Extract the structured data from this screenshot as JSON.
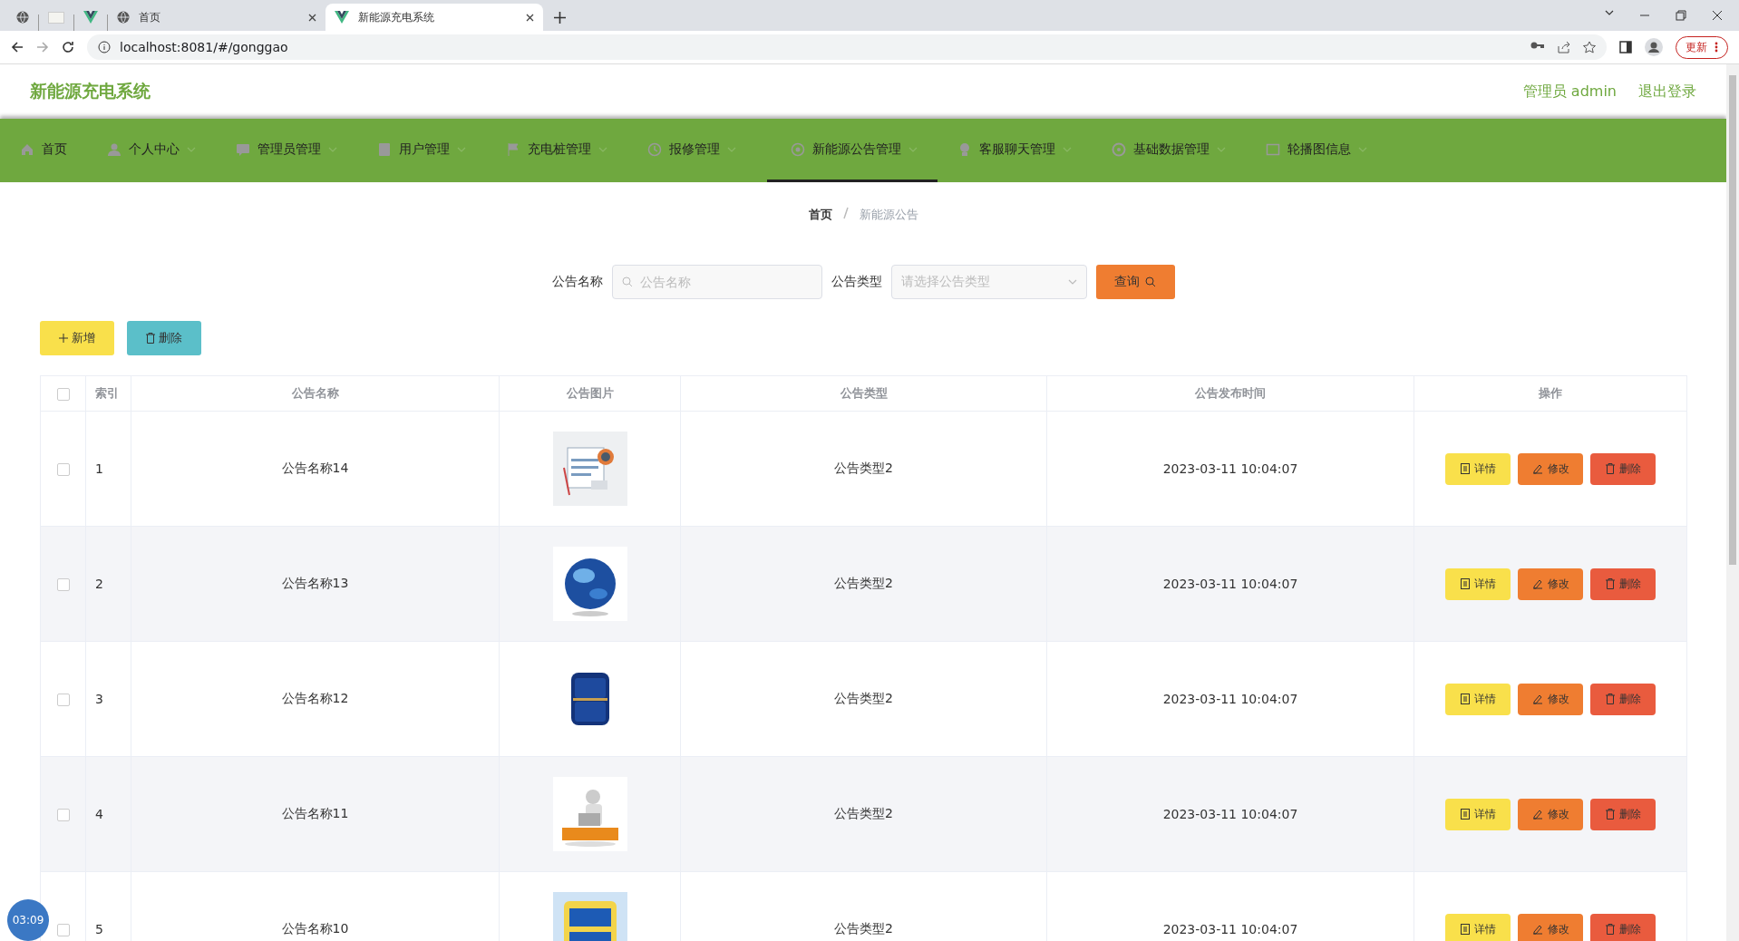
{
  "browser": {
    "tabs": [
      {
        "kind": "globe",
        "selected": false
      },
      {
        "kind": "blank",
        "selected": false
      },
      {
        "kind": "vue",
        "selected": false
      },
      {
        "kind": "globe",
        "title": "首页",
        "selected": false
      },
      {
        "kind": "vue",
        "title": "新能源充电系统",
        "selected": true
      }
    ],
    "url": "localhost:8081/#/gonggao",
    "update_button": "更新"
  },
  "header": {
    "title": "新能源充电系统",
    "user": "管理员 admin",
    "logout": "退出登录"
  },
  "nav": [
    {
      "label": "首页",
      "dropdown": false,
      "selected": false
    },
    {
      "label": "个人中心",
      "dropdown": true,
      "selected": false
    },
    {
      "label": "管理员管理",
      "dropdown": true,
      "selected": false
    },
    {
      "label": "用户管理",
      "dropdown": true,
      "selected": false
    },
    {
      "label": "充电桩管理",
      "dropdown": true,
      "selected": false
    },
    {
      "label": "报修管理",
      "dropdown": true,
      "selected": false
    },
    {
      "label": "新能源公告管理",
      "dropdown": true,
      "selected": true
    },
    {
      "label": "客服聊天管理",
      "dropdown": true,
      "selected": false
    },
    {
      "label": "基础数据管理",
      "dropdown": true,
      "selected": false
    },
    {
      "label": "轮播图信息",
      "dropdown": true,
      "selected": false
    }
  ],
  "breadcrumb": [
    "首页",
    "新能源公告"
  ],
  "search": {
    "name_label": "公告名称",
    "name_placeholder": "公告名称",
    "type_label": "公告类型",
    "type_placeholder": "请选择公告类型",
    "query_button": "查询"
  },
  "toolbar": [
    {
      "kind": "add",
      "label": "新增"
    },
    {
      "kind": "delete",
      "label": "删除"
    }
  ],
  "table": {
    "select_all_checked": false,
    "columns": [
      "索引",
      "公告名称",
      "公告图片",
      "公告类型",
      "公告发布时间",
      "操作"
    ],
    "rows": [
      {
        "index": "1",
        "name": "公告名称14",
        "type": "公告类型2",
        "time": "2023-03-11 10:04:07",
        "selected": false,
        "actions": [
          {
            "kind": "detail",
            "label": "详情"
          },
          {
            "kind": "edit",
            "label": "修改"
          },
          {
            "kind": "delete",
            "label": "删除"
          }
        ]
      },
      {
        "index": "2",
        "name": "公告名称13",
        "type": "公告类型2",
        "time": "2023-03-11 10:04:07",
        "selected": false,
        "actions": [
          {
            "kind": "detail",
            "label": "详情"
          },
          {
            "kind": "edit",
            "label": "修改"
          },
          {
            "kind": "delete",
            "label": "删除"
          }
        ]
      },
      {
        "index": "3",
        "name": "公告名称12",
        "type": "公告类型2",
        "time": "2023-03-11 10:04:07",
        "selected": false,
        "actions": [
          {
            "kind": "detail",
            "label": "详情"
          },
          {
            "kind": "edit",
            "label": "修改"
          },
          {
            "kind": "delete",
            "label": "删除"
          }
        ]
      },
      {
        "index": "4",
        "name": "公告名称11",
        "type": "公告类型2",
        "time": "2023-03-11 10:04:07",
        "selected": false,
        "actions": [
          {
            "kind": "detail",
            "label": "详情"
          },
          {
            "kind": "edit",
            "label": "修改"
          },
          {
            "kind": "delete",
            "label": "删除"
          }
        ]
      },
      {
        "index": "5",
        "name": "公告名称10",
        "type": "公告类型2",
        "time": "2023-03-11 10:04:07",
        "selected": false,
        "actions": [
          {
            "kind": "detail",
            "label": "详情"
          },
          {
            "kind": "edit",
            "label": "修改"
          },
          {
            "kind": "delete",
            "label": "删除"
          }
        ]
      }
    ]
  },
  "timer_badge": "03:09"
}
